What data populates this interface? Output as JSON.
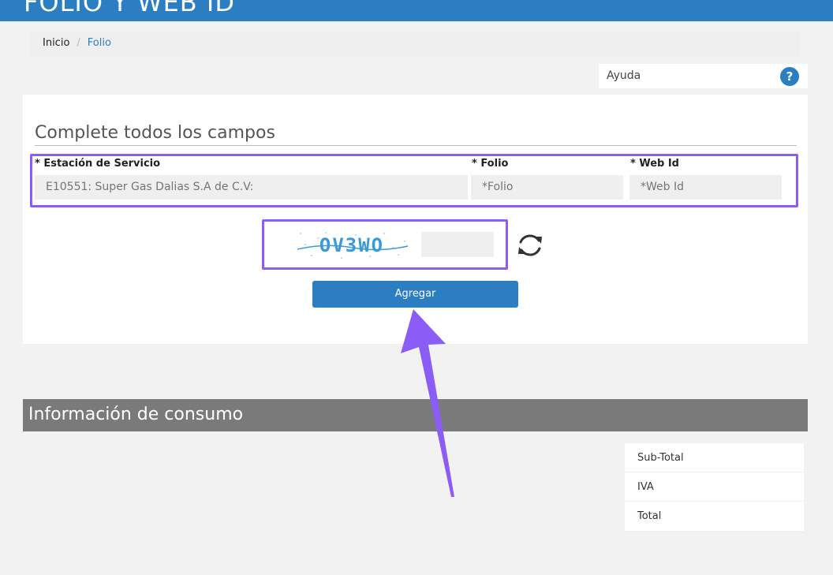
{
  "header": {
    "title": "FOLIO Y WEB ID"
  },
  "breadcrumb": {
    "home": "Inicio",
    "separator": "/",
    "current": "Folio"
  },
  "help": {
    "label": "Ayuda",
    "icon": "question-icon",
    "glyph": "?"
  },
  "form": {
    "heading": "Complete todos los campos",
    "station": {
      "label": "* Estación de Servicio",
      "placeholder": "E10551: Super Gas Dalias S.A de C.V:"
    },
    "folio": {
      "label": "* Folio",
      "placeholder": "*Folio"
    },
    "webid": {
      "label": "* Web Id",
      "placeholder": "*Web Id"
    },
    "captcha": {
      "text": "OV3WO",
      "value": "",
      "refresh_icon": "refresh-icon"
    },
    "submit_label": "Agregar"
  },
  "consumo": {
    "title": "Información de consumo",
    "rows": [
      "Sub-Total",
      "IVA",
      "Total"
    ]
  },
  "colors": {
    "brand": "#2b7ec1",
    "highlight": "#8b5cf6",
    "info_bar": "#7a7a7a"
  }
}
